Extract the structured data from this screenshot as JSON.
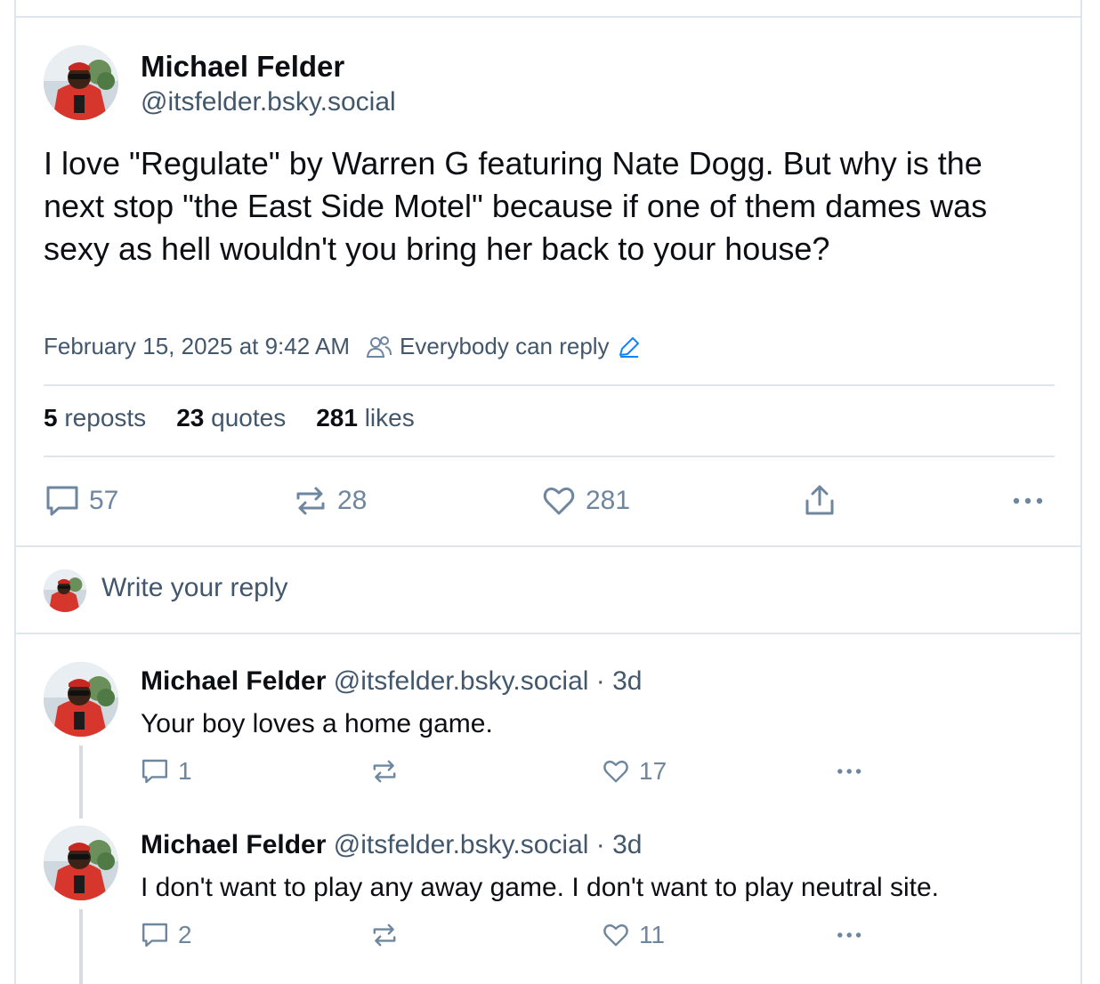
{
  "post": {
    "author_name": "Michael Felder",
    "author_handle": "@itsfelder.bsky.social",
    "text": "I love \"Regulate\" by Warren G featuring Nate Dogg. But why is the next stop \"the East Side Motel\" because if one of them dames was sexy as hell wouldn't you bring her back to your house?",
    "timestamp": "February 15, 2025 at 9:42 AM",
    "reply_setting": "Everybody can reply",
    "stats": {
      "reposts_count": "5",
      "reposts_label": "reposts",
      "quotes_count": "23",
      "quotes_label": "quotes",
      "likes_count": "281",
      "likes_label": "likes"
    },
    "actions": {
      "replies": "57",
      "reposts": "28",
      "likes": "281"
    }
  },
  "composer": {
    "placeholder": "Write your reply"
  },
  "replies": [
    {
      "author_name": "Michael Felder",
      "author_handle": "@itsfelder.bsky.social",
      "age": "· 3d",
      "text": "Your boy loves a home game.",
      "replies": "1",
      "reposts": "",
      "likes": "17"
    },
    {
      "author_name": "Michael Felder",
      "author_handle": "@itsfelder.bsky.social",
      "age": "· 3d",
      "text": "I don't want to play any away game. I don't want to play neutral site.",
      "replies": "2",
      "reposts": "",
      "likes": "11"
    }
  ],
  "icons": {
    "reply": "speech-bubble-icon",
    "repost": "repost-arrows-icon",
    "like": "heart-icon",
    "share": "share-icon",
    "more": "ellipsis-icon",
    "audience": "people-icon",
    "edit": "pencil-icon"
  },
  "colors": {
    "muted": "#42576c",
    "icon": "#6f869f",
    "accent": "#1083fe",
    "border": "#dfe5ec"
  }
}
